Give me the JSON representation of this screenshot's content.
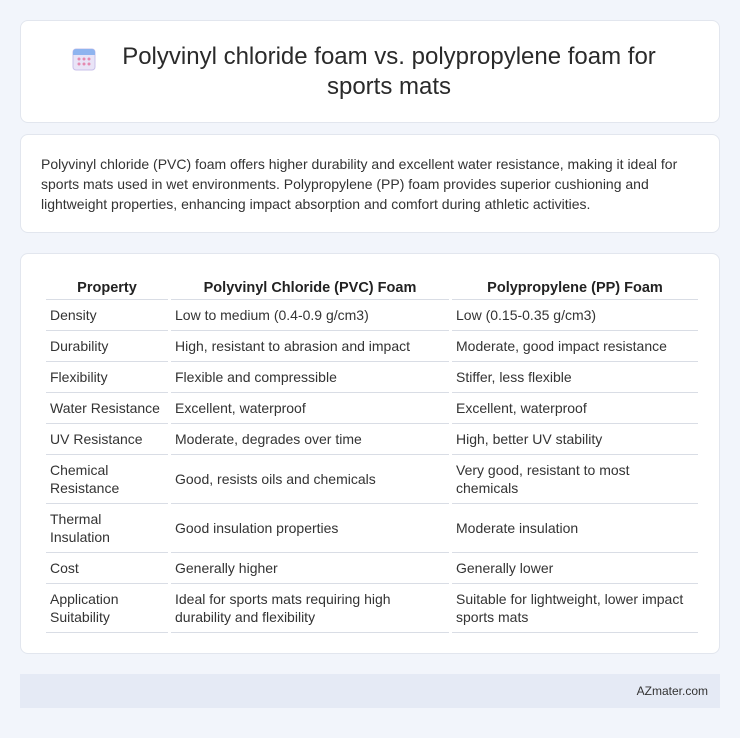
{
  "header": {
    "title": "Polyvinyl chloride foam vs. polypropylene foam for sports mats",
    "icon": "calendar-icon"
  },
  "summary": {
    "text": "Polyvinyl chloride (PVC) foam offers higher durability and excellent water resistance, making it ideal for sports mats used in wet environments. Polypropylene (PP) foam provides superior cushioning and lightweight properties, enhancing impact absorption and comfort during athletic activities."
  },
  "table": {
    "headers": [
      "Property",
      "Polyvinyl Chloride (PVC) Foam",
      "Polypropylene (PP) Foam"
    ],
    "rows": [
      [
        "Density",
        "Low to medium (0.4-0.9 g/cm3)",
        "Low (0.15-0.35 g/cm3)"
      ],
      [
        "Durability",
        "High, resistant to abrasion and impact",
        "Moderate, good impact resistance"
      ],
      [
        "Flexibility",
        "Flexible and compressible",
        "Stiffer, less flexible"
      ],
      [
        "Water Resistance",
        "Excellent, waterproof",
        "Excellent, waterproof"
      ],
      [
        "UV Resistance",
        "Moderate, degrades over time",
        "High, better UV stability"
      ],
      [
        "Chemical Resistance",
        "Good, resists oils and chemicals",
        "Very good, resistant to most chemicals"
      ],
      [
        "Thermal Insulation",
        "Good insulation properties",
        "Moderate insulation"
      ],
      [
        "Cost",
        "Generally higher",
        "Generally lower"
      ],
      [
        "Application Suitability",
        "Ideal for sports mats requiring high durability and flexibility",
        "Suitable for lightweight, lower impact sports mats"
      ]
    ]
  },
  "footer": {
    "brand": "AZmater.com"
  }
}
